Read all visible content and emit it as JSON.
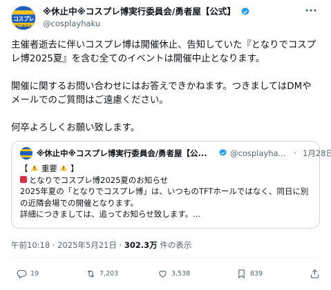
{
  "author": {
    "display_name": "※休止中※コスプレ博実行委員会/勇者屋【公式】",
    "handle": "@cosplayhaku",
    "avatar_text": "コスプレ",
    "avatar_subtext": "実行委員会"
  },
  "tweet": {
    "paragraphs": [
      "主催者逝去に伴いコスプレ博は開催休止、告知していた『となりでコスプ",
      "レ博2025夏』を含む全てのイベントは開催中止となります。",
      "",
      "開催に関するお問い合わせにはお答えできかねます。つきましてはDMや",
      "メールでのご質問はご遠慮ください。",
      "",
      "何卒よろしくお願い致します。"
    ]
  },
  "quoted": {
    "display_name": "※休止中※コスプレ博実行委員会/勇者屋【公...",
    "handle": "@cosplayha...",
    "dot": "·",
    "date": "1月28日",
    "line1_label": "重要",
    "line1_open": "【",
    "line1_close": "】",
    "line2": "となりでコスプレ博2025夏のお知らせ",
    "line3": "2025年夏の「となりでコスプレ博」は、いつものTFTホールではなく、同日に別",
    "line4": "の近隣会場での開催となります。",
    "line5": "詳細につきましては、追ってお知らせ致します。..."
  },
  "meta": {
    "time": "午前10:18",
    "sep1": " · ",
    "date": "2025年5月21日",
    "sep2": " · ",
    "views": "302.3万",
    "views_label": " 件の表示"
  },
  "actions": {
    "replies": "19",
    "reposts": "7,203",
    "likes": "3,538",
    "bookmarks": "839"
  },
  "colors": {
    "verified": "#1d9bf0",
    "text": "#0f1419",
    "muted": "#536471",
    "border": "#cfd9de"
  }
}
